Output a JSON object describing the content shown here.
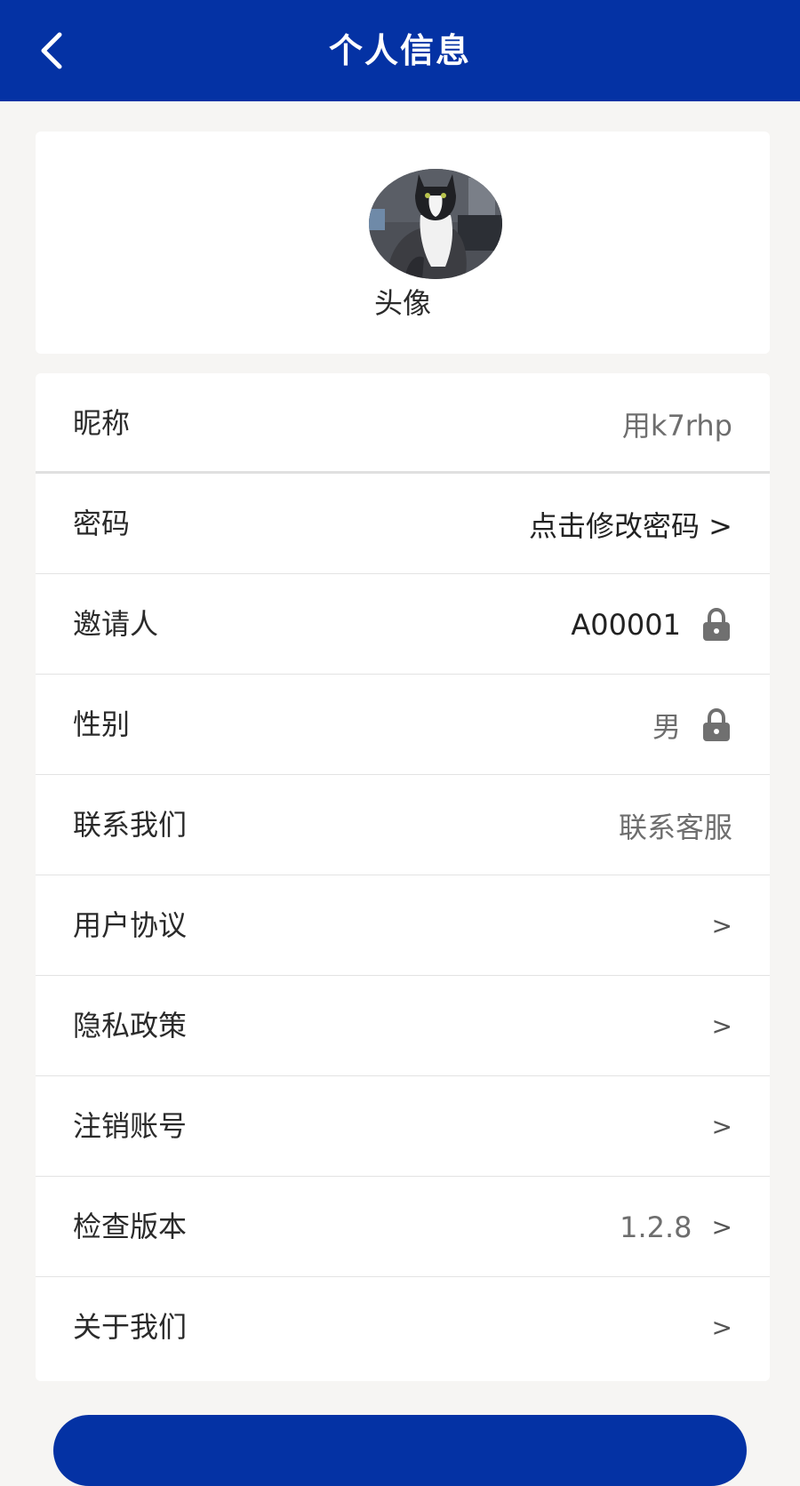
{
  "header": {
    "title": "个人信息"
  },
  "avatar": {
    "label": "头像"
  },
  "rows": [
    {
      "label": "昵称",
      "value": "用k7rhp"
    },
    {
      "label": "密码",
      "value": "点击修改密码 >"
    },
    {
      "label": "邀请人",
      "value": "A00001"
    },
    {
      "label": "性别",
      "value": "男"
    },
    {
      "label": "联系我们",
      "value": "联系客服"
    },
    {
      "label": "用户协议",
      "chevron": ">"
    },
    {
      "label": "隐私政策",
      "chevron": ">"
    },
    {
      "label": "注销账号",
      "chevron": ">"
    },
    {
      "label": "检查版本",
      "value": "1.2.8",
      "chevron": ">"
    },
    {
      "label": "关于我们",
      "chevron": ">"
    }
  ],
  "icons": {
    "back": "chevron-left-icon",
    "lock": "lock-icon"
  },
  "colors": {
    "brand": "#0432a4",
    "background": "#f6f5f3",
    "card": "#ffffff"
  }
}
